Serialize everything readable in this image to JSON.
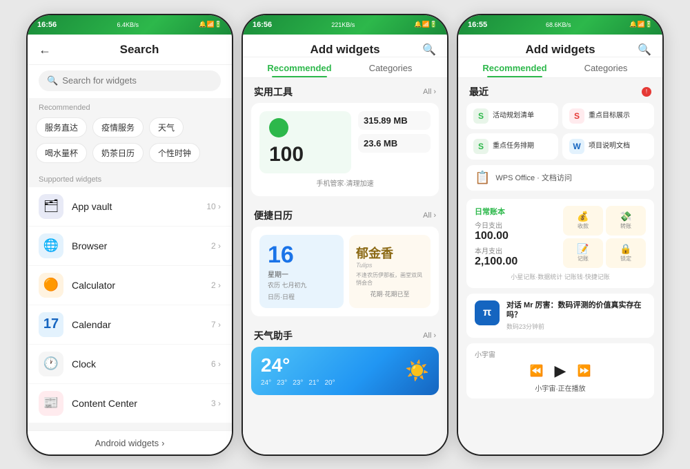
{
  "phone1": {
    "status": {
      "time": "16:56",
      "speed": "6.4KB/s",
      "icons": "🔔 📶 🔋"
    },
    "header": {
      "back_label": "←",
      "title": "Search"
    },
    "search": {
      "placeholder": "Search for widgets"
    },
    "recommended_label": "Recommended",
    "chips": [
      "服务直达",
      "疫情服务",
      "天气",
      "喝水量杯",
      "奶茶日历",
      "个性时钟"
    ],
    "supported_label": "Supported widgets",
    "widgets": [
      {
        "name": "App vault",
        "count": "10",
        "icon": "🗂",
        "icon_color": "#5c6bc0"
      },
      {
        "name": "Browser",
        "count": "2",
        "icon": "🌐",
        "icon_color": "#1976d2"
      },
      {
        "name": "Calculator",
        "count": "2",
        "icon": "🟠",
        "icon_color": "#f57c00"
      },
      {
        "name": "Calendar",
        "count": "7",
        "icon": "📅",
        "icon_color": "#1565c0"
      },
      {
        "name": "Clock",
        "count": "6",
        "icon": "🕐",
        "icon_color": "#424242"
      },
      {
        "name": "Content Center",
        "count": "3",
        "icon": "📰",
        "icon_color": "#c62828"
      }
    ],
    "android_widgets_label": "Android widgets"
  },
  "phone2": {
    "status": {
      "time": "16:56",
      "speed": "221KB/s"
    },
    "header": {
      "title": "Add widgets"
    },
    "tabs": [
      "Recommended",
      "Categories"
    ],
    "sections": [
      {
        "title": "实用工具",
        "all_label": "All",
        "type": "phone_manager",
        "big_num": "100",
        "mb1": "315.89 MB",
        "mb2": "23.6 MB",
        "subtitle": "手机管家·清理加速"
      },
      {
        "title": "便捷日历",
        "all_label": "All",
        "type": "calendar",
        "day_num": "16",
        "day_name": "星期一",
        "date_label": "农历 七月初九",
        "nav_label": "日历·日程",
        "flower_title": "郁金香",
        "flower_sub": "Tulips",
        "flower_poem": "不逢农历伊那板，画堂双凤悄会合",
        "right_label": "花期·花期已至"
      },
      {
        "title": "天气助手",
        "all_label": "All",
        "type": "weather",
        "temp": "24°",
        "temps_row": [
          "24°",
          "23°",
          "23°",
          "21°",
          "20°"
        ]
      }
    ]
  },
  "phone3": {
    "status": {
      "time": "16:55",
      "speed": "68.6KB/s"
    },
    "header": {
      "title": "Add widgets"
    },
    "tabs": [
      "Recommended",
      "Categories"
    ],
    "recent_label": "最近",
    "recent_apps": [
      {
        "name": "活动规划清单",
        "icon": "S",
        "color": "#2db84b"
      },
      {
        "name": "重点目标展示",
        "icon": "S",
        "color": "#e53935"
      },
      {
        "name": "重点任务排期",
        "icon": "S",
        "color": "#2db84b"
      },
      {
        "name": "项目说明文档",
        "icon": "W",
        "color": "#1565c0"
      }
    ],
    "wps_label": "WPS Office · 文档访问",
    "finance": {
      "app_name": "日常账本",
      "today_label": "今日支出",
      "today_amount": "100.00",
      "month_label": "本月支出",
      "month_amount": "2,100.00",
      "btns": [
        "收款",
        "转账",
        "记账",
        "锁定"
      ],
      "footer": "小星记账·数据统计  记账钱·快捷记账"
    },
    "article": {
      "title": "对话 Mr 厉害：数码评测的价值真实存在吗？",
      "meta": "数码23分钟前",
      "icon": "π"
    },
    "music": {
      "label": "小宇宙",
      "song": "小宇宙·正在播放"
    }
  }
}
